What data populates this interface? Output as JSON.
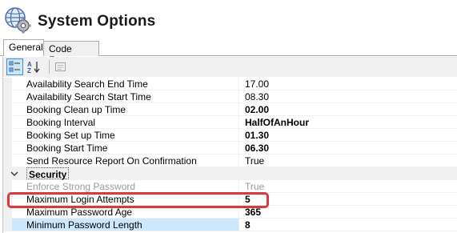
{
  "header": {
    "title": "System Options",
    "icon": "globe-gear-icon"
  },
  "tabs": [
    {
      "label": "General",
      "active": true
    },
    {
      "label": "Code Format",
      "active": false
    }
  ],
  "toolbar": {
    "categorized_icon": "categorized-view-icon",
    "alphabetical_icon": "alphabetical-sort-icon",
    "property_pages_icon": "property-pages-icon"
  },
  "grid": {
    "rows": [
      {
        "name": "Availability Search End Time",
        "value": "17.00",
        "bold": false
      },
      {
        "name": "Availability Search Start Time",
        "value": "08.30",
        "bold": false
      },
      {
        "name": "Booking Clean up Time",
        "value": "02.00",
        "bold": true
      },
      {
        "name": "Booking Interval",
        "value": "HalfOfAnHour",
        "bold": true
      },
      {
        "name": "Booking Set up Time",
        "value": "01.30",
        "bold": true
      },
      {
        "name": "Booking Start Time",
        "value": "06.30",
        "bold": true
      },
      {
        "name": "Send Resource Report On Confirmation",
        "value": "True",
        "bold": false
      }
    ],
    "category": {
      "label": "Security",
      "expanded": true
    },
    "security_rows": [
      {
        "name": "Enforce Strong Password",
        "value": "True",
        "bold": false,
        "disabled": true
      },
      {
        "name": "Maximum Login Attempts",
        "value": "5",
        "bold": true,
        "highlighted": true
      },
      {
        "name": "Maximum Password Age",
        "value": "365",
        "bold": true
      },
      {
        "name": "Minimum Password Length",
        "value": "8",
        "bold": true
      }
    ]
  },
  "colors": {
    "highlight_border": "#d9393d",
    "selected_row": "#cce8ff",
    "toolbar_pressed": "#cce4f7"
  }
}
